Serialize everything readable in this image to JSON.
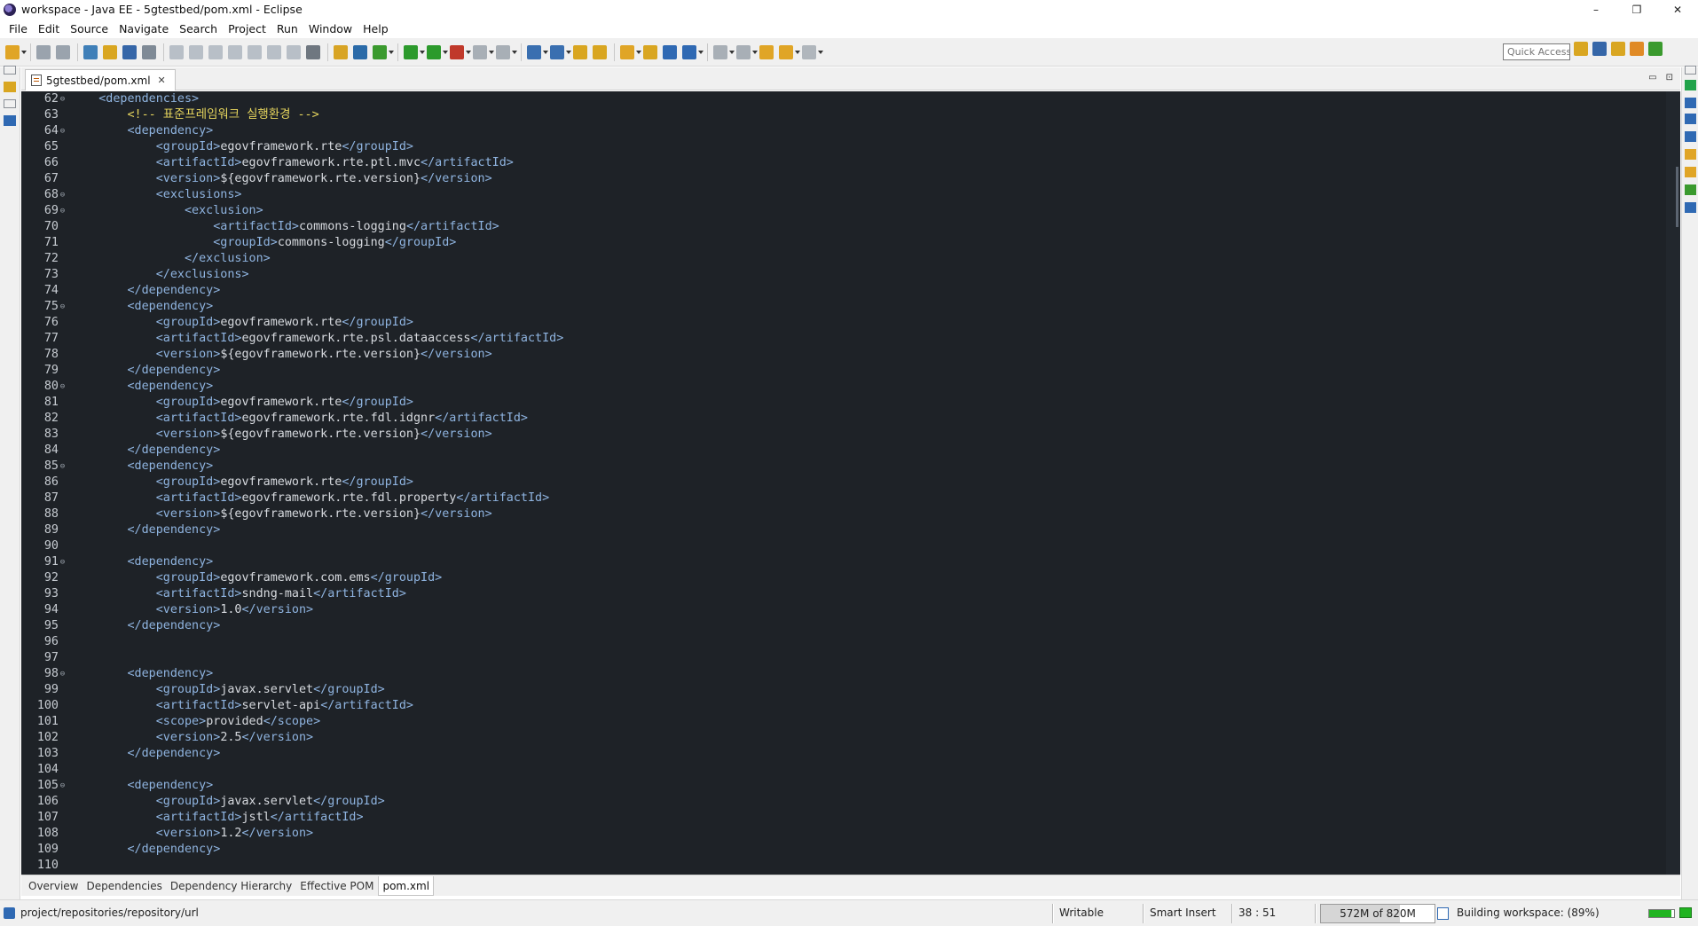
{
  "window": {
    "title": "workspace - Java EE - 5gtestbed/pom.xml - Eclipse"
  },
  "window_controls": {
    "minimize": "–",
    "restore": "❐",
    "close": "✕"
  },
  "menu": [
    "File",
    "Edit",
    "Source",
    "Navigate",
    "Search",
    "Project",
    "Run",
    "Window",
    "Help"
  ],
  "toolbar": {
    "quick_access_placeholder": "Quick Access",
    "buttons": [
      {
        "name": "new-wizard-icon",
        "color": "#e0a526",
        "drop": true
      },
      {
        "name": "save-icon",
        "color": "#9aa3ad"
      },
      {
        "name": "save-all-icon",
        "color": "#9aa3ad"
      },
      {
        "name": "new-java-project-icon",
        "color": "#3f7fb8"
      },
      {
        "name": "open-type-icon",
        "color": "#d9a621"
      },
      {
        "name": "server-icon",
        "color": "#3566a8"
      },
      {
        "name": "skip-breakpoints-icon",
        "color": "#7f8a96"
      },
      {
        "name": "resume-icon",
        "color": "#b8bfc7"
      },
      {
        "name": "suspend-icon",
        "color": "#b8bfc7"
      },
      {
        "name": "terminate-icon",
        "color": "#b8bfc7"
      },
      {
        "name": "disconnect-icon",
        "color": "#b8bfc7"
      },
      {
        "name": "step-into-icon",
        "color": "#b8bfc7"
      },
      {
        "name": "step-over-icon",
        "color": "#b8bfc7"
      },
      {
        "name": "step-return-icon",
        "color": "#b8bfc7"
      },
      {
        "name": "console-icon",
        "color": "#6f7780"
      },
      {
        "name": "build-icon",
        "color": "#d8a424"
      },
      {
        "name": "connect-icon",
        "color": "#2a6aa8"
      },
      {
        "name": "debug-icon",
        "color": "#3a9a2e",
        "drop": true
      },
      {
        "name": "run-icon",
        "color": "#2c9a2c",
        "drop": true
      },
      {
        "name": "coverage-icon",
        "color": "#2c9a2c",
        "drop": true
      },
      {
        "name": "external-tools-icon",
        "color": "#c0392b",
        "drop": true
      },
      {
        "name": "stop-icon",
        "color": "#a8afb6",
        "drop": true
      },
      {
        "name": "deploy-icon",
        "color": "#a8afb6",
        "drop": true
      },
      {
        "name": "new-server-icon",
        "color": "#3a6fb0",
        "drop": true
      },
      {
        "name": "new-servlet-icon",
        "color": "#3a6fb0",
        "drop": true
      },
      {
        "name": "open-folder-icon",
        "color": "#d9a621"
      },
      {
        "name": "open-task-icon",
        "color": "#d9a621"
      },
      {
        "name": "search-icon",
        "color": "#e0a526",
        "drop": true
      },
      {
        "name": "open-perspective-icon",
        "color": "#d9a621"
      },
      {
        "name": "web-browser-icon",
        "color": "#2f69b3"
      },
      {
        "name": "team-sync-icon",
        "color": "#2f69b3",
        "drop": true
      },
      {
        "name": "next-annotation-icon",
        "color": "#a8afb6",
        "drop": true
      },
      {
        "name": "previous-annotation-icon",
        "color": "#a8afb6",
        "drop": true
      },
      {
        "name": "last-edit-location-icon",
        "color": "#e0a526"
      },
      {
        "name": "back-icon",
        "color": "#e0a526",
        "drop": true
      },
      {
        "name": "forward-icon",
        "color": "#b0b6bc",
        "drop": true
      }
    ],
    "perspectives": [
      {
        "name": "open-perspective-button-icon",
        "color": "#d9a621"
      },
      {
        "name": "java-ee-perspective-icon",
        "color": "#3566a8"
      },
      {
        "name": "jpa-perspective-icon",
        "color": "#d9a621"
      },
      {
        "name": "java-perspective-icon",
        "color": "#e08a26"
      },
      {
        "name": "debug-perspective-icon",
        "color": "#3a9a2e"
      }
    ]
  },
  "editor_tab": {
    "label": "5gtestbed/pom.xml",
    "close": "✕"
  },
  "editor_minmax": {
    "minimize": "▭",
    "maximize": "⊡"
  },
  "code_lines": [
    {
      "n": "62",
      "fold": true,
      "indent": 1,
      "segs": [
        [
          "t",
          "<dependencies>"
        ]
      ]
    },
    {
      "n": "63",
      "fold": false,
      "indent": 2,
      "segs": [
        [
          "c",
          "<!-- 표준프레임워크 실행환경 -->"
        ]
      ]
    },
    {
      "n": "64",
      "fold": true,
      "indent": 2,
      "segs": [
        [
          "t",
          "<dependency>"
        ]
      ]
    },
    {
      "n": "65",
      "fold": false,
      "indent": 3,
      "segs": [
        [
          "t",
          "<groupId>"
        ],
        [
          "x",
          "egovframework.rte"
        ],
        [
          "t",
          "</groupId>"
        ]
      ]
    },
    {
      "n": "66",
      "fold": false,
      "indent": 3,
      "segs": [
        [
          "t",
          "<artifactId>"
        ],
        [
          "x",
          "egovframework.rte.ptl.mvc"
        ],
        [
          "t",
          "</artifactId>"
        ]
      ]
    },
    {
      "n": "67",
      "fold": false,
      "indent": 3,
      "segs": [
        [
          "t",
          "<version>"
        ],
        [
          "x",
          "${egovframework.rte.version}"
        ],
        [
          "t",
          "</version>"
        ]
      ]
    },
    {
      "n": "68",
      "fold": true,
      "indent": 3,
      "segs": [
        [
          "t",
          "<exclusions>"
        ]
      ]
    },
    {
      "n": "69",
      "fold": true,
      "indent": 4,
      "segs": [
        [
          "t",
          "<exclusion>"
        ]
      ]
    },
    {
      "n": "70",
      "fold": false,
      "indent": 5,
      "segs": [
        [
          "t",
          "<artifactId>"
        ],
        [
          "x",
          "commons-logging"
        ],
        [
          "t",
          "</artifactId>"
        ]
      ]
    },
    {
      "n": "71",
      "fold": false,
      "indent": 5,
      "segs": [
        [
          "t",
          "<groupId>"
        ],
        [
          "x",
          "commons-logging"
        ],
        [
          "t",
          "</groupId>"
        ]
      ]
    },
    {
      "n": "72",
      "fold": false,
      "indent": 4,
      "segs": [
        [
          "t",
          "</exclusion>"
        ]
      ]
    },
    {
      "n": "73",
      "fold": false,
      "indent": 3,
      "segs": [
        [
          "t",
          "</exclusions>"
        ]
      ]
    },
    {
      "n": "74",
      "fold": false,
      "indent": 2,
      "segs": [
        [
          "t",
          "</dependency>"
        ]
      ]
    },
    {
      "n": "75",
      "fold": true,
      "indent": 2,
      "segs": [
        [
          "t",
          "<dependency>"
        ]
      ]
    },
    {
      "n": "76",
      "fold": false,
      "indent": 3,
      "segs": [
        [
          "t",
          "<groupId>"
        ],
        [
          "x",
          "egovframework.rte"
        ],
        [
          "t",
          "</groupId>"
        ]
      ]
    },
    {
      "n": "77",
      "fold": false,
      "indent": 3,
      "segs": [
        [
          "t",
          "<artifactId>"
        ],
        [
          "x",
          "egovframework.rte.psl.dataaccess"
        ],
        [
          "t",
          "</artifactId>"
        ]
      ]
    },
    {
      "n": "78",
      "fold": false,
      "indent": 3,
      "segs": [
        [
          "t",
          "<version>"
        ],
        [
          "x",
          "${egovframework.rte.version}"
        ],
        [
          "t",
          "</version>"
        ]
      ]
    },
    {
      "n": "79",
      "fold": false,
      "indent": 2,
      "segs": [
        [
          "t",
          "</dependency>"
        ]
      ]
    },
    {
      "n": "80",
      "fold": true,
      "indent": 2,
      "segs": [
        [
          "t",
          "<dependency>"
        ]
      ]
    },
    {
      "n": "81",
      "fold": false,
      "indent": 3,
      "segs": [
        [
          "t",
          "<groupId>"
        ],
        [
          "x",
          "egovframework.rte"
        ],
        [
          "t",
          "</groupId>"
        ]
      ]
    },
    {
      "n": "82",
      "fold": false,
      "indent": 3,
      "segs": [
        [
          "t",
          "<artifactId>"
        ],
        [
          "x",
          "egovframework.rte.fdl.idgnr"
        ],
        [
          "t",
          "</artifactId>"
        ]
      ]
    },
    {
      "n": "83",
      "fold": false,
      "indent": 3,
      "segs": [
        [
          "t",
          "<version>"
        ],
        [
          "x",
          "${egovframework.rte.version}"
        ],
        [
          "t",
          "</version>"
        ]
      ]
    },
    {
      "n": "84",
      "fold": false,
      "indent": 2,
      "segs": [
        [
          "t",
          "</dependency>"
        ]
      ]
    },
    {
      "n": "85",
      "fold": true,
      "indent": 2,
      "segs": [
        [
          "t",
          "<dependency>"
        ]
      ]
    },
    {
      "n": "86",
      "fold": false,
      "indent": 3,
      "segs": [
        [
          "t",
          "<groupId>"
        ],
        [
          "x",
          "egovframework.rte"
        ],
        [
          "t",
          "</groupId>"
        ]
      ]
    },
    {
      "n": "87",
      "fold": false,
      "indent": 3,
      "segs": [
        [
          "t",
          "<artifactId>"
        ],
        [
          "x",
          "egovframework.rte.fdl.property"
        ],
        [
          "t",
          "</artifactId>"
        ]
      ]
    },
    {
      "n": "88",
      "fold": false,
      "indent": 3,
      "segs": [
        [
          "t",
          "<version>"
        ],
        [
          "x",
          "${egovframework.rte.version}"
        ],
        [
          "t",
          "</version>"
        ]
      ]
    },
    {
      "n": "89",
      "fold": false,
      "indent": 2,
      "segs": [
        [
          "t",
          "</dependency>"
        ]
      ]
    },
    {
      "n": "90",
      "fold": false,
      "indent": 0,
      "segs": []
    },
    {
      "n": "91",
      "fold": true,
      "indent": 2,
      "segs": [
        [
          "t",
          "<dependency>"
        ]
      ]
    },
    {
      "n": "92",
      "fold": false,
      "indent": 3,
      "segs": [
        [
          "t",
          "<groupId>"
        ],
        [
          "x",
          "egovframework.com.ems"
        ],
        [
          "t",
          "</groupId>"
        ]
      ]
    },
    {
      "n": "93",
      "fold": false,
      "indent": 3,
      "segs": [
        [
          "t",
          "<artifactId>"
        ],
        [
          "x",
          "sndng-mail"
        ],
        [
          "t",
          "</artifactId>"
        ]
      ]
    },
    {
      "n": "94",
      "fold": false,
      "indent": 3,
      "segs": [
        [
          "t",
          "<version>"
        ],
        [
          "x",
          "1.0"
        ],
        [
          "t",
          "</version>"
        ]
      ]
    },
    {
      "n": "95",
      "fold": false,
      "indent": 2,
      "segs": [
        [
          "t",
          "</dependency>"
        ]
      ]
    },
    {
      "n": "96",
      "fold": false,
      "indent": 0,
      "segs": []
    },
    {
      "n": "97",
      "fold": false,
      "indent": 0,
      "segs": []
    },
    {
      "n": "98",
      "fold": true,
      "indent": 2,
      "segs": [
        [
          "t",
          "<dependency>"
        ]
      ]
    },
    {
      "n": "99",
      "fold": false,
      "indent": 3,
      "segs": [
        [
          "t",
          "<groupId>"
        ],
        [
          "x",
          "javax.servlet"
        ],
        [
          "t",
          "</groupId>"
        ]
      ]
    },
    {
      "n": "100",
      "fold": false,
      "indent": 3,
      "segs": [
        [
          "t",
          "<artifactId>"
        ],
        [
          "x",
          "servlet-api"
        ],
        [
          "t",
          "</artifactId>"
        ]
      ]
    },
    {
      "n": "101",
      "fold": false,
      "indent": 3,
      "segs": [
        [
          "t",
          "<scope>"
        ],
        [
          "x",
          "provided"
        ],
        [
          "t",
          "</scope>"
        ]
      ]
    },
    {
      "n": "102",
      "fold": false,
      "indent": 3,
      "segs": [
        [
          "t",
          "<version>"
        ],
        [
          "x",
          "2.5"
        ],
        [
          "t",
          "</version>"
        ]
      ]
    },
    {
      "n": "103",
      "fold": false,
      "indent": 2,
      "segs": [
        [
          "t",
          "</dependency>"
        ]
      ]
    },
    {
      "n": "104",
      "fold": false,
      "indent": 0,
      "segs": []
    },
    {
      "n": "105",
      "fold": true,
      "indent": 2,
      "segs": [
        [
          "t",
          "<dependency>"
        ]
      ]
    },
    {
      "n": "106",
      "fold": false,
      "indent": 3,
      "segs": [
        [
          "t",
          "<groupId>"
        ],
        [
          "x",
          "javax.servlet"
        ],
        [
          "t",
          "</groupId>"
        ]
      ]
    },
    {
      "n": "107",
      "fold": false,
      "indent": 3,
      "segs": [
        [
          "t",
          "<artifactId>"
        ],
        [
          "x",
          "jstl"
        ],
        [
          "t",
          "</artifactId>"
        ]
      ]
    },
    {
      "n": "108",
      "fold": false,
      "indent": 3,
      "segs": [
        [
          "t",
          "<version>"
        ],
        [
          "x",
          "1.2"
        ],
        [
          "t",
          "</version>"
        ]
      ]
    },
    {
      "n": "109",
      "fold": false,
      "indent": 2,
      "segs": [
        [
          "t",
          "</dependency>"
        ]
      ]
    },
    {
      "n": "110",
      "fold": false,
      "indent": 0,
      "segs": []
    }
  ],
  "page_tabs": [
    {
      "label": "Overview",
      "active": false
    },
    {
      "label": "Dependencies",
      "active": false
    },
    {
      "label": "Dependency Hierarchy",
      "active": false
    },
    {
      "label": "Effective POM",
      "active": false
    },
    {
      "label": "pom.xml",
      "active": true
    }
  ],
  "status": {
    "path": "project/repositories/repository/url",
    "writable": "Writable",
    "insert_mode": "Smart Insert",
    "cursor_position": "38 : 51",
    "heap": "572M of 820M",
    "heap_used_fraction": 0.6976,
    "build_status": "Building workspace: (89%)",
    "build_progress_fraction": 0.89
  },
  "colors": {
    "editor_bg": "#1e2227",
    "xml_tag": "#8fb4e0",
    "xml_text": "#d7dadf",
    "xml_comment": "#e8d75e"
  }
}
